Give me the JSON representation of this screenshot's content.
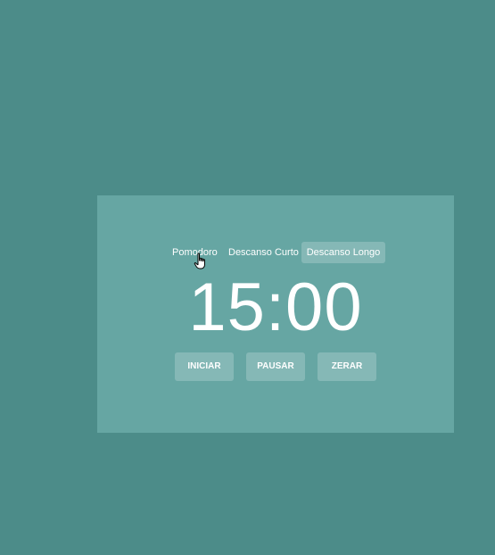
{
  "colors": {
    "background": "#4c8c89",
    "card": "#66a6a3",
    "active_tab": "#85b8b6",
    "button": "#85b8b6",
    "text": "#ffffff"
  },
  "tabs": [
    {
      "label": "Pomodoro",
      "active": false
    },
    {
      "label": "Descanso Curto",
      "active": false
    },
    {
      "label": "Descanso Longo",
      "active": true
    }
  ],
  "timer": {
    "display": "15:00"
  },
  "controls": {
    "start_label": "INICIAR",
    "pause_label": "PAUSAR",
    "reset_label": "ZERAR"
  },
  "cursor": {
    "icon": "hand-pointer-icon"
  }
}
